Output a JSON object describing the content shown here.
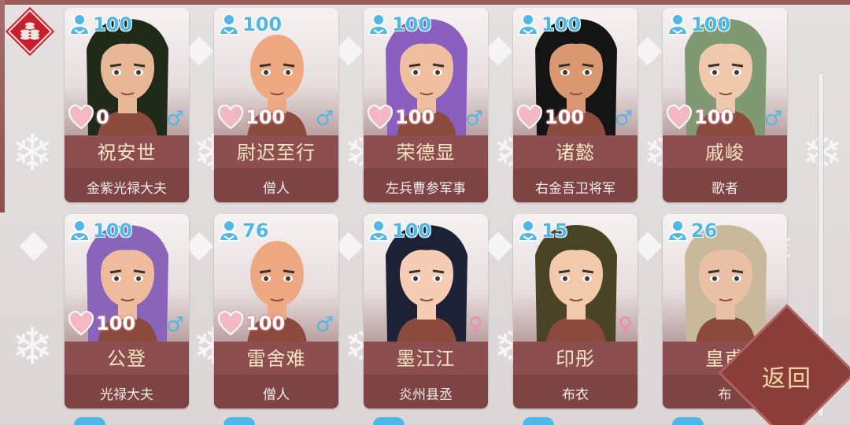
{
  "return_button": {
    "label": "返回"
  },
  "rows": [
    [
      {
        "stat": "100",
        "heart": "0",
        "gender": "♂",
        "gender_type": "male",
        "name": "祝安世",
        "role": "金紫光禄大夫",
        "hair": "#1f2a18",
        "skin": "#e8b796"
      },
      {
        "stat": "100",
        "heart": "100",
        "gender": "♂",
        "gender_type": "male",
        "name": "尉迟至行",
        "role": "僧人",
        "hair": "none",
        "skin": "#eea882"
      },
      {
        "stat": "100",
        "heart": "100",
        "gender": "♂",
        "gender_type": "male",
        "name": "荣德显",
        "role": "左兵曹参军事",
        "hair": "#8a5fc0",
        "skin": "#efbf9f"
      },
      {
        "stat": "100",
        "heart": "100",
        "gender": "♂",
        "gender_type": "male",
        "name": "诸懿",
        "role": "右金吾卫将军",
        "hair": "#141414",
        "skin": "#d99870"
      },
      {
        "stat": "100",
        "heart": "100",
        "gender": "♂",
        "gender_type": "male",
        "name": "戚峻",
        "role": "歌者",
        "hair": "#7f9a72",
        "skin": "#f0c8ae"
      }
    ],
    [
      {
        "stat": "100",
        "heart": "100",
        "gender": "♂",
        "gender_type": "male",
        "name": "公登",
        "role": "光禄大夫",
        "hair": "#8a64b8",
        "skin": "#eebc9c"
      },
      {
        "stat": "76",
        "heart": "100",
        "gender": "♂",
        "gender_type": "male",
        "name": "雷舍难",
        "role": "僧人",
        "hair": "none",
        "skin": "#eea882"
      },
      {
        "stat": "100",
        "heart": "",
        "gender": "♀",
        "gender_type": "female",
        "name": "墨江江",
        "role": "炎州县丞",
        "hair": "#1d2136",
        "skin": "#f4cdb4"
      },
      {
        "stat": "15",
        "heart": "",
        "gender": "♀",
        "gender_type": "female",
        "name": "印彤",
        "role": "布衣",
        "hair": "#4a4426",
        "skin": "#f3c9ac"
      },
      {
        "stat": "26",
        "heart": "",
        "gender": "",
        "gender_type": "female",
        "name": "皇甫",
        "role": "布",
        "hair": "#c9b89a",
        "skin": "#e9c0a5"
      }
    ]
  ]
}
